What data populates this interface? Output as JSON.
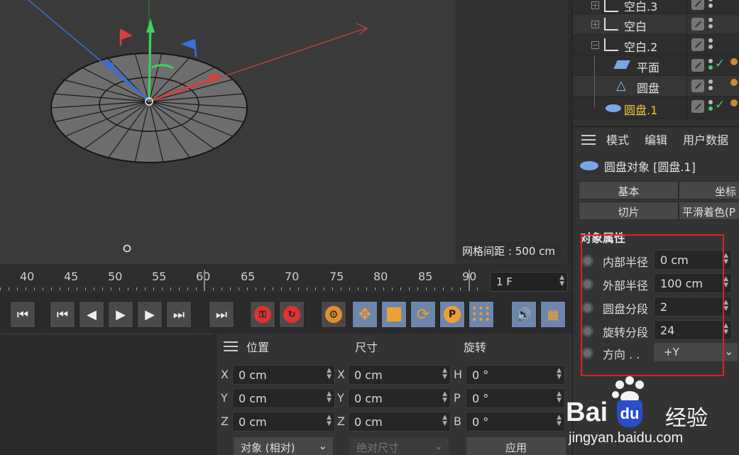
{
  "viewport": {
    "grid_spacing": "网格间距 : 500 cm"
  },
  "timeline": {
    "ticks": [
      "40",
      "45",
      "50",
      "55",
      "60",
      "65",
      "70",
      "75",
      "80",
      "85",
      "90"
    ],
    "current_frame": "1 F"
  },
  "coord_manager": {
    "headers": {
      "position": "位置",
      "size": "尺寸",
      "rotation": "旋转"
    },
    "position": [
      {
        "axis": "X",
        "value": "0 cm"
      },
      {
        "axis": "Y",
        "value": "0 cm"
      },
      {
        "axis": "Z",
        "value": "0 cm"
      }
    ],
    "size": [
      {
        "axis": "X",
        "value": "0 cm"
      },
      {
        "axis": "Y",
        "value": "0 cm"
      },
      {
        "axis": "Z",
        "value": "0 cm"
      }
    ],
    "rotation": [
      {
        "axis": "H",
        "value": "0 °"
      },
      {
        "axis": "P",
        "value": "0 °"
      },
      {
        "axis": "B",
        "value": "0 °"
      }
    ],
    "mode_dropdown": "对象 (相对)",
    "size_dropdown": "绝对尺寸",
    "apply_button": "应用"
  },
  "object_manager": {
    "items": [
      {
        "name": "空白.3"
      },
      {
        "name": "空白"
      },
      {
        "name": "空白.2"
      },
      {
        "name": "平面"
      },
      {
        "name": "圆盘"
      },
      {
        "name": "圆盘.1"
      }
    ]
  },
  "attributes": {
    "menu": [
      "模式",
      "编辑",
      "用户数据"
    ],
    "object_title": "圆盘对象 [圆盘.1]",
    "tabs": [
      "基本",
      "坐标",
      "切片",
      "平滑着色(P"
    ],
    "section_title": "对象属性",
    "properties": [
      {
        "label": "内部半径",
        "value": "0 cm"
      },
      {
        "label": "外部半径",
        "value": "100 cm"
      },
      {
        "label": "圆盘分段",
        "value": "2"
      },
      {
        "label": "旋转分段",
        "value": "24"
      },
      {
        "label": "方向 . .",
        "value": "+Y"
      }
    ]
  },
  "watermark": {
    "brand": "Bai",
    "brand2": "经验",
    "url": "jingyan.baidu.com"
  },
  "colors": {
    "highlight_name": "#f3c93c",
    "accent_blue": "#6d86ad",
    "record_red": "#d33333",
    "annotation_red": "#e02020"
  }
}
